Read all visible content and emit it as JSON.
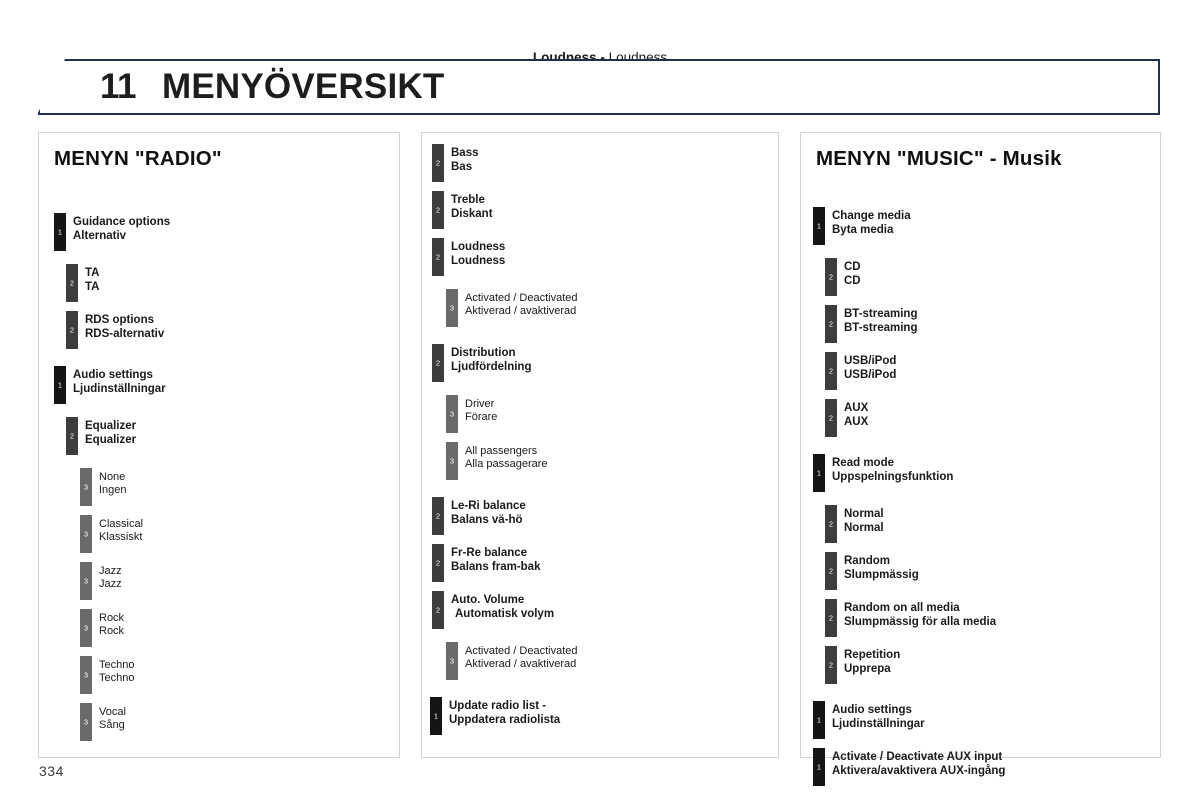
{
  "running_head": {
    "bold_part": "Loudness",
    "separator": " - ",
    "plain_part": "Loudness"
  },
  "chapter": {
    "number": "11",
    "title": "MENYÖVERSIKT"
  },
  "page_number": "334",
  "columns": [
    {
      "id": "radio",
      "title": "MENYN \"RADIO\"",
      "nodes": [
        {
          "level": 1,
          "en": "Guidance options",
          "sv": "Alternativ"
        },
        {
          "level": 2,
          "en": "TA",
          "sv": "TA"
        },
        {
          "level": 2,
          "en": "RDS options",
          "sv": "RDS-alternativ"
        },
        {
          "level": 1,
          "en": "Audio settings",
          "sv": "Ljudinställningar"
        },
        {
          "level": 2,
          "en": "Equalizer",
          "sv": "Equalizer"
        },
        {
          "level": 3,
          "en": "None",
          "sv": "Ingen"
        },
        {
          "level": 3,
          "en": "Classical",
          "sv": "Klassiskt"
        },
        {
          "level": 3,
          "en": "Jazz",
          "sv": "Jazz"
        },
        {
          "level": 3,
          "en": "Rock",
          "sv": "Rock"
        },
        {
          "level": 3,
          "en": "Techno",
          "sv": "Techno"
        },
        {
          "level": 3,
          "en": "Vocal",
          "sv": "Sång"
        }
      ]
    },
    {
      "id": "audio-continued",
      "title": "",
      "nodes": [
        {
          "level": 2,
          "en": "Bass",
          "sv": "Bas"
        },
        {
          "level": 2,
          "en": "Treble",
          "sv": "Diskant"
        },
        {
          "level": 2,
          "en": "Loudness",
          "sv": "Loudness"
        },
        {
          "level": 3,
          "en": "Activated / Deactivated",
          "sv": "Aktiverad / avaktiverad"
        },
        {
          "level": 2,
          "en": "Distribution",
          "sv": "Ljudfördelning"
        },
        {
          "level": 3,
          "en": "Driver",
          "sv": "Förare"
        },
        {
          "level": 3,
          "en": "All passengers",
          "sv": "Alla passagerare"
        },
        {
          "level": 2,
          "en": "Le-Ri balance",
          "sv": "Balans vä-hö"
        },
        {
          "level": 2,
          "en": "Fr-Re balance",
          "sv": "Balans fram-bak"
        },
        {
          "level": 2,
          "en": "Auto. Volume",
          "sv": "Automatisk volym"
        },
        {
          "level": 3,
          "en": "Activated / Deactivated",
          "sv": "Aktiverad / avaktiverad"
        },
        {
          "level": 1,
          "en": "Update radio list -",
          "sv": "Uppdatera radiolista"
        }
      ]
    },
    {
      "id": "music",
      "title": "MENYN \"MUSIC\" - Musik",
      "nodes": [
        {
          "level": 1,
          "en": "Change media",
          "sv": "Byta media"
        },
        {
          "level": 2,
          "en": "CD",
          "sv": "CD"
        },
        {
          "level": 2,
          "en": "BT-streaming",
          "sv": "BT-streaming"
        },
        {
          "level": 2,
          "en": "USB/iPod",
          "sv": "USB/iPod"
        },
        {
          "level": 2,
          "en": "AUX",
          "sv": "AUX"
        },
        {
          "level": 1,
          "en": "Read mode",
          "sv": "Uppspelningsfunktion"
        },
        {
          "level": 2,
          "en": "Normal",
          "sv": "Normal"
        },
        {
          "level": 2,
          "en": "Random",
          "sv": "Slumpmässig"
        },
        {
          "level": 2,
          "en": "Random on all media",
          "sv": "Slumpmässig för alla media"
        },
        {
          "level": 2,
          "en": "Repetition",
          "sv": "Upprepa"
        },
        {
          "level": 1,
          "en": "Audio settings",
          "sv": "Ljudinställningar"
        },
        {
          "level": 1,
          "en": "Activate / Deactivate AUX input",
          "sv": "Aktivera/avaktivera AUX-ingång"
        }
      ]
    }
  ],
  "colors": {
    "level1_bar": "#151515",
    "level2_bar": "#3d3d3d",
    "level3_bar": "#6a6a6a",
    "banner_border": "#22304f"
  }
}
